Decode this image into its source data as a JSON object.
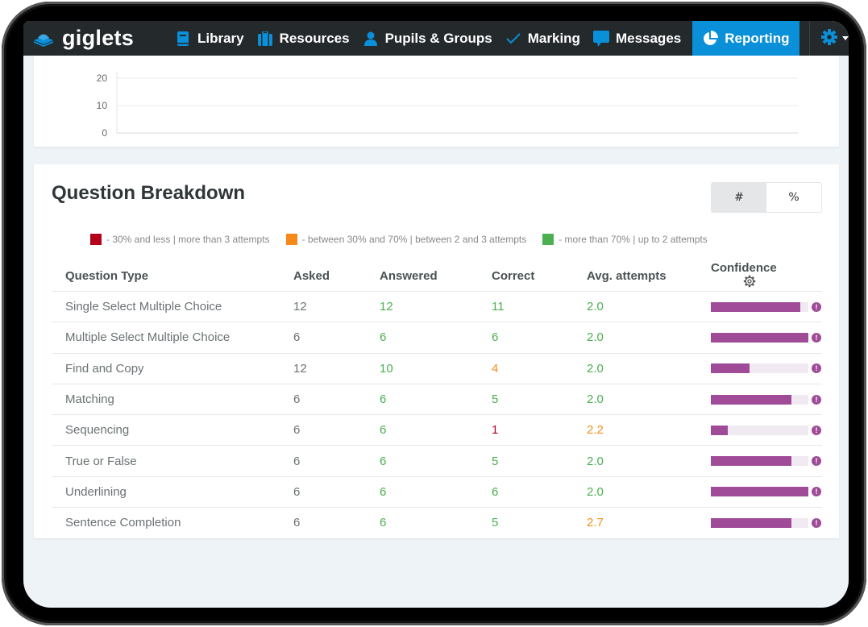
{
  "brand": {
    "name": "giglets",
    "logo_icon": "book-stack-icon"
  },
  "nav": {
    "items": [
      {
        "label": "Library",
        "icon": "book-icon"
      },
      {
        "label": "Resources",
        "icon": "briefcase-icon"
      },
      {
        "label": "Pupils & Groups",
        "icon": "user-icon"
      },
      {
        "label": "Marking",
        "icon": "checkmark-icon"
      },
      {
        "label": "Messages",
        "icon": "speech-bubble-icon"
      },
      {
        "label": "Reporting",
        "icon": "pie-chart-icon",
        "active": true
      }
    ],
    "settings_icon": "gear-icon"
  },
  "colors": {
    "nav_bg": "#24292c",
    "accent": "#0a8fd9",
    "low": "#b3001b",
    "mid": "#f0901a",
    "high": "#4caf50",
    "confidence": "#9f4b97"
  },
  "chart_data": {
    "type": "bar",
    "title": "",
    "xlabel": "",
    "ylabel": "",
    "y_ticks": [
      0,
      10,
      20
    ],
    "ylim": [
      0,
      20
    ],
    "categories": [],
    "values": [],
    "grid": true
  },
  "breakdown": {
    "title": "Question Breakdown",
    "toggle": {
      "count_label": "#",
      "percent_label": "%",
      "selected": "#"
    },
    "legend": [
      {
        "color": "#b3001b",
        "text": "- 30% and less | more than 3 attempts"
      },
      {
        "color": "#f7891b",
        "text": "- between 30% and 70% | between 2 and 3 attempts"
      },
      {
        "color": "#4caf50",
        "text": "- more than 70% | up to 2 attempts"
      }
    ],
    "columns": [
      "Question Type",
      "Asked",
      "Answered",
      "Correct",
      "Avg. attempts",
      "Confidence"
    ],
    "rows": [
      {
        "type": "Single Select Multiple Choice",
        "asked": "12",
        "answered": "12",
        "answered_level": "high",
        "correct": "11",
        "correct_level": "high",
        "avg": "2.0",
        "avg_level": "high",
        "confidence": 0.92
      },
      {
        "type": "Multiple Select Multiple Choice",
        "asked": "6",
        "answered": "6",
        "answered_level": "high",
        "correct": "6",
        "correct_level": "high",
        "avg": "2.0",
        "avg_level": "high",
        "confidence": 1.0
      },
      {
        "type": "Find and Copy",
        "asked": "12",
        "answered": "10",
        "answered_level": "high",
        "correct": "4",
        "correct_level": "mid",
        "avg": "2.0",
        "avg_level": "high",
        "confidence": 0.4
      },
      {
        "type": "Matching",
        "asked": "6",
        "answered": "6",
        "answered_level": "high",
        "correct": "5",
        "correct_level": "high",
        "avg": "2.0",
        "avg_level": "high",
        "confidence": 0.83
      },
      {
        "type": "Sequencing",
        "asked": "6",
        "answered": "6",
        "answered_level": "high",
        "correct": "1",
        "correct_level": "low",
        "avg": "2.2",
        "avg_level": "mid",
        "confidence": 0.17
      },
      {
        "type": "True or False",
        "asked": "6",
        "answered": "6",
        "answered_level": "high",
        "correct": "5",
        "correct_level": "high",
        "avg": "2.0",
        "avg_level": "high",
        "confidence": 0.83
      },
      {
        "type": "Underlining",
        "asked": "6",
        "answered": "6",
        "answered_level": "high",
        "correct": "6",
        "correct_level": "high",
        "avg": "2.0",
        "avg_level": "high",
        "confidence": 1.0
      },
      {
        "type": "Sentence Completion",
        "asked": "6",
        "answered": "6",
        "answered_level": "high",
        "correct": "5",
        "correct_level": "high",
        "avg": "2.7",
        "avg_level": "mid",
        "confidence": 0.83
      }
    ]
  }
}
